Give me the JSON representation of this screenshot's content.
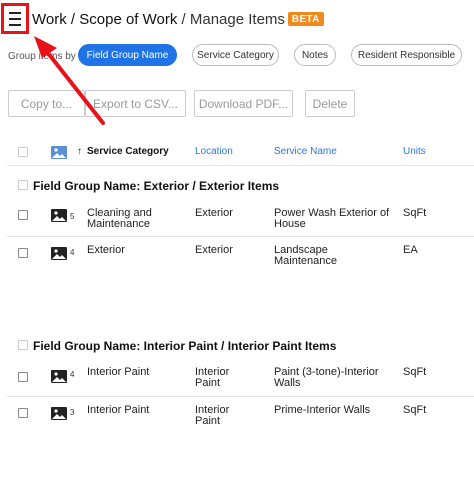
{
  "header": {
    "breadcrumb_work": "Work",
    "sep1": " / ",
    "breadcrumb_sow": "Scope of Work",
    "sep2": " / ",
    "current": "Manage Items",
    "badge": "BETA"
  },
  "group_by": {
    "label": "Group items by",
    "options": [
      "Field Group Name",
      "Service Category",
      "Notes",
      "Resident Responsible"
    ],
    "active": "Field Group Name"
  },
  "toolbar": {
    "copy": "Copy to...",
    "export": "Export to CSV...",
    "download": "Download PDF...",
    "delete": "Delete"
  },
  "table": {
    "columns": {
      "service_category": "Service Category",
      "location": "Location",
      "service_name": "Service Name",
      "units": "Units"
    },
    "groups": [
      {
        "title": "Field Group Name: Exterior / Exterior Items",
        "rows": [
          {
            "count": "5",
            "category": "Cleaning and Maintenance",
            "location": "Exterior",
            "service": "Power Wash Exterior of House",
            "units": "SqFt"
          },
          {
            "count": "4",
            "category": "Exterior",
            "location": "Exterior",
            "service": "Landscape Maintenance",
            "units": "EA"
          }
        ]
      },
      {
        "title": "Field Group Name: Interior Paint / Interior Paint Items",
        "rows": [
          {
            "count": "4",
            "category": "Interior Paint",
            "location": "Interior Paint",
            "service": "Paint (3-tone)-Interior Walls",
            "units": "SqFt"
          },
          {
            "count": "3",
            "category": "Interior Paint",
            "location": "Interior Paint",
            "service": "Prime-Interior Walls",
            "units": "SqFt"
          }
        ]
      }
    ]
  },
  "colors": {
    "accent": "#1f73e6",
    "badge": "#f08a1c",
    "annotation": "#e8121b",
    "link": "#2b79d4"
  }
}
